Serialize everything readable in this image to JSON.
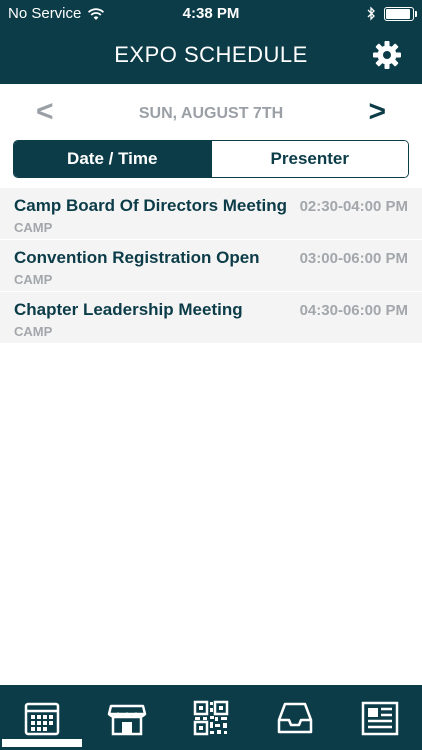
{
  "status_bar": {
    "carrier": "No Service",
    "time": "4:38 PM",
    "battery_level": 0.85
  },
  "header": {
    "title": "EXPO SCHEDULE",
    "settings_icon": "gear-icon"
  },
  "date_nav": {
    "prev": "<",
    "label": "SUN, AUGUST 7TH",
    "next": ">"
  },
  "segments": [
    {
      "label": "Date / Time",
      "active": true
    },
    {
      "label": "Presenter",
      "active": false
    }
  ],
  "events": [
    {
      "title": "Camp Board Of Directors Meeting",
      "category": "CAMP",
      "time": "02:30-04:00 PM"
    },
    {
      "title": "Convention Registration Open",
      "category": "CAMP",
      "time": "03:00-06:00 PM"
    },
    {
      "title": "Chapter Leadership Meeting",
      "category": "CAMP",
      "time": "04:30-06:00 PM"
    }
  ],
  "tabs": [
    {
      "icon": "calendar-icon",
      "active": true
    },
    {
      "icon": "storefront-icon",
      "active": false
    },
    {
      "icon": "qr-code-icon",
      "active": false
    },
    {
      "icon": "inbox-tray-icon",
      "active": false
    },
    {
      "icon": "newspaper-icon",
      "active": false
    }
  ],
  "colors": {
    "primary": "#0c3c48",
    "muted": "#a3a7ab",
    "row_bg": "#f4f4f4"
  }
}
